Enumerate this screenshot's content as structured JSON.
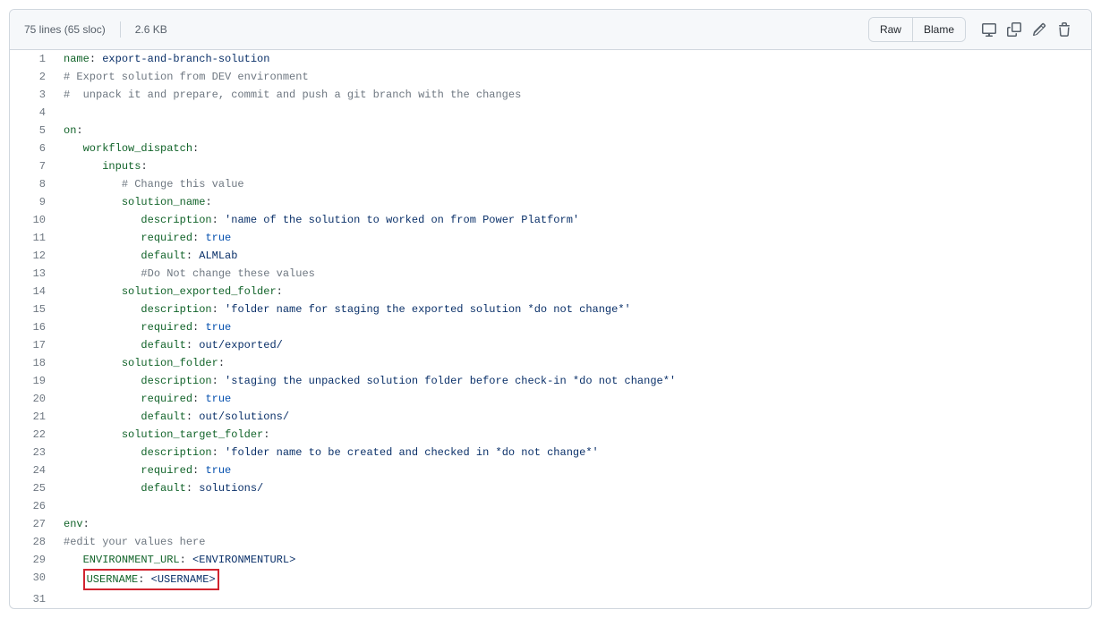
{
  "header": {
    "lines_info": "75 lines (65 sloc)",
    "size_info": "2.6 KB",
    "raw_label": "Raw",
    "blame_label": "Blame"
  },
  "code": {
    "lines": [
      {
        "n": 1,
        "segs": [
          {
            "c": "tok-key",
            "t": "name"
          },
          {
            "c": "tok-plain",
            "t": ": "
          },
          {
            "c": "tok-str",
            "t": "export-and-branch-solution"
          }
        ]
      },
      {
        "n": 2,
        "segs": [
          {
            "c": "tok-com",
            "t": "# Export solution from DEV environment"
          }
        ]
      },
      {
        "n": 3,
        "segs": [
          {
            "c": "tok-com",
            "t": "#  unpack it and prepare, commit and push a git branch with the changes"
          }
        ]
      },
      {
        "n": 4,
        "segs": []
      },
      {
        "n": 5,
        "segs": [
          {
            "c": "tok-key",
            "t": "on"
          },
          {
            "c": "tok-plain",
            "t": ":"
          }
        ]
      },
      {
        "n": 6,
        "indent": 1,
        "segs": [
          {
            "c": "tok-key",
            "t": "workflow_dispatch"
          },
          {
            "c": "tok-plain",
            "t": ":"
          }
        ]
      },
      {
        "n": 7,
        "indent": 2,
        "segs": [
          {
            "c": "tok-key",
            "t": "inputs"
          },
          {
            "c": "tok-plain",
            "t": ":"
          }
        ]
      },
      {
        "n": 8,
        "indent": 3,
        "segs": [
          {
            "c": "tok-com",
            "t": "# Change this value"
          }
        ]
      },
      {
        "n": 9,
        "indent": 3,
        "segs": [
          {
            "c": "tok-key",
            "t": "solution_name"
          },
          {
            "c": "tok-plain",
            "t": ":"
          }
        ]
      },
      {
        "n": 10,
        "indent": 4,
        "segs": [
          {
            "c": "tok-key",
            "t": "description"
          },
          {
            "c": "tok-plain",
            "t": ": "
          },
          {
            "c": "tok-str",
            "t": "'name of the solution to worked on from Power Platform'"
          }
        ]
      },
      {
        "n": 11,
        "indent": 4,
        "segs": [
          {
            "c": "tok-key",
            "t": "required"
          },
          {
            "c": "tok-plain",
            "t": ": "
          },
          {
            "c": "tok-bool",
            "t": "true"
          }
        ]
      },
      {
        "n": 12,
        "indent": 4,
        "segs": [
          {
            "c": "tok-key",
            "t": "default"
          },
          {
            "c": "tok-plain",
            "t": ": "
          },
          {
            "c": "tok-str",
            "t": "ALMLab"
          }
        ]
      },
      {
        "n": 13,
        "indent": 4,
        "segs": [
          {
            "c": "tok-com",
            "t": "#Do Not change these values"
          }
        ]
      },
      {
        "n": 14,
        "indent": 3,
        "segs": [
          {
            "c": "tok-key",
            "t": "solution_exported_folder"
          },
          {
            "c": "tok-plain",
            "t": ":"
          }
        ]
      },
      {
        "n": 15,
        "indent": 4,
        "segs": [
          {
            "c": "tok-key",
            "t": "description"
          },
          {
            "c": "tok-plain",
            "t": ": "
          },
          {
            "c": "tok-str",
            "t": "'folder name for staging the exported solution *do not change*'"
          }
        ]
      },
      {
        "n": 16,
        "indent": 4,
        "segs": [
          {
            "c": "tok-key",
            "t": "required"
          },
          {
            "c": "tok-plain",
            "t": ": "
          },
          {
            "c": "tok-bool",
            "t": "true"
          }
        ]
      },
      {
        "n": 17,
        "indent": 4,
        "segs": [
          {
            "c": "tok-key",
            "t": "default"
          },
          {
            "c": "tok-plain",
            "t": ": "
          },
          {
            "c": "tok-str",
            "t": "out/exported/"
          }
        ]
      },
      {
        "n": 18,
        "indent": 3,
        "segs": [
          {
            "c": "tok-key",
            "t": "solution_folder"
          },
          {
            "c": "tok-plain",
            "t": ":"
          }
        ]
      },
      {
        "n": 19,
        "indent": 4,
        "segs": [
          {
            "c": "tok-key",
            "t": "description"
          },
          {
            "c": "tok-plain",
            "t": ": "
          },
          {
            "c": "tok-str",
            "t": "'staging the unpacked solution folder before check-in *do not change*'"
          }
        ]
      },
      {
        "n": 20,
        "indent": 4,
        "segs": [
          {
            "c": "tok-key",
            "t": "required"
          },
          {
            "c": "tok-plain",
            "t": ": "
          },
          {
            "c": "tok-bool",
            "t": "true"
          }
        ]
      },
      {
        "n": 21,
        "indent": 4,
        "segs": [
          {
            "c": "tok-key",
            "t": "default"
          },
          {
            "c": "tok-plain",
            "t": ": "
          },
          {
            "c": "tok-str",
            "t": "out/solutions/"
          }
        ]
      },
      {
        "n": 22,
        "indent": 3,
        "segs": [
          {
            "c": "tok-key",
            "t": "solution_target_folder"
          },
          {
            "c": "tok-plain",
            "t": ":"
          }
        ]
      },
      {
        "n": 23,
        "indent": 4,
        "segs": [
          {
            "c": "tok-key",
            "t": "description"
          },
          {
            "c": "tok-plain",
            "t": ": "
          },
          {
            "c": "tok-str",
            "t": "'folder name to be created and checked in *do not change*'"
          }
        ]
      },
      {
        "n": 24,
        "indent": 4,
        "segs": [
          {
            "c": "tok-key",
            "t": "required"
          },
          {
            "c": "tok-plain",
            "t": ": "
          },
          {
            "c": "tok-bool",
            "t": "true"
          }
        ]
      },
      {
        "n": 25,
        "indent": 4,
        "segs": [
          {
            "c": "tok-key",
            "t": "default"
          },
          {
            "c": "tok-plain",
            "t": ": "
          },
          {
            "c": "tok-str",
            "t": "solutions/"
          }
        ]
      },
      {
        "n": 26,
        "segs": []
      },
      {
        "n": 27,
        "segs": [
          {
            "c": "tok-key",
            "t": "env"
          },
          {
            "c": "tok-plain",
            "t": ":"
          }
        ]
      },
      {
        "n": 28,
        "segs": [
          {
            "c": "tok-com",
            "t": "#edit your values here"
          }
        ]
      },
      {
        "n": 29,
        "indent": 1,
        "segs": [
          {
            "c": "tok-key",
            "t": "ENVIRONMENT_URL"
          },
          {
            "c": "tok-plain",
            "t": ": "
          },
          {
            "c": "tok-str",
            "t": "<ENVIRONMENTURL>"
          }
        ]
      },
      {
        "n": 30,
        "indent": 1,
        "highlight": true,
        "segs": [
          {
            "c": "tok-key",
            "t": "USERNAME"
          },
          {
            "c": "tok-plain",
            "t": ": "
          },
          {
            "c": "tok-str",
            "t": "<USERNAME>"
          }
        ]
      },
      {
        "n": 31,
        "segs": []
      }
    ]
  }
}
